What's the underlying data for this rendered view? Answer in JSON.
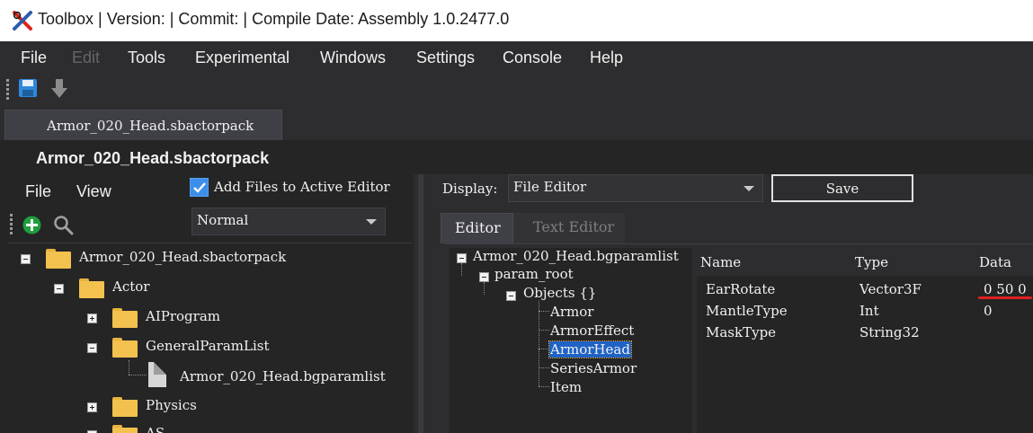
{
  "window": {
    "title": "Toolbox | Version:  | Commit:  | Compile Date:  Assembly 1.0.2477.0",
    "app_icon": "crossed-tools-icon"
  },
  "menubar": {
    "items": [
      "File",
      "Edit",
      "Tools",
      "Experimental",
      "Windows",
      "Settings",
      "Console",
      "Help"
    ],
    "disabled": [
      "Edit"
    ]
  },
  "toolbar": {
    "icons": [
      "save-icon",
      "import-arrow-icon"
    ]
  },
  "document_tab": {
    "label": "Armor_020_Head.sbactorpack"
  },
  "document_header": {
    "title": "Armor_020_Head.sbactorpack"
  },
  "left_pane": {
    "menu": [
      "File",
      "View"
    ],
    "add_files_checkbox": {
      "label": "Add Files to Active Editor",
      "checked": true
    },
    "view_mode": "Normal",
    "tool_icons": [
      "add-icon",
      "search-icon"
    ],
    "tree": [
      {
        "label": "Armor_020_Head.sbactorpack",
        "type": "folder",
        "expanded": true
      },
      {
        "label": "Actor",
        "type": "folder",
        "expanded": true
      },
      {
        "label": "AIProgram",
        "type": "folder",
        "expanded": false
      },
      {
        "label": "GeneralParamList",
        "type": "folder",
        "expanded": true
      },
      {
        "label": "Armor_020_Head.bgparamlist",
        "type": "file"
      },
      {
        "label": "Physics",
        "type": "folder",
        "expanded": false
      },
      {
        "label": "AS",
        "type": "folder",
        "expanded": false
      }
    ]
  },
  "right_pane": {
    "display_label": "Display:",
    "display_value": "File Editor",
    "save_label": "Save",
    "tabs": [
      {
        "label": "Editor",
        "active": true
      },
      {
        "label": "Text Editor",
        "active": false
      }
    ],
    "param_tree": {
      "root": "Armor_020_Head.bgparamlist",
      "param_root": "param_root",
      "objects": "Objects {}",
      "children": [
        "Armor",
        "ArmorEffect",
        "ArmorHead",
        "SeriesArmor",
        "Item"
      ],
      "selected": "ArmorHead"
    },
    "grid": {
      "headers": [
        "Name",
        "Type",
        "Data"
      ],
      "rows": [
        {
          "name": "EarRotate",
          "type": "Vector3F",
          "data": "0 50 0"
        },
        {
          "name": "MantleType",
          "type": "Int",
          "data": "0"
        },
        {
          "name": "MaskType",
          "type": "String32",
          "data": ""
        }
      ],
      "highlight_color": "#e01f1f"
    }
  },
  "colors": {
    "background": "#2d2d30",
    "panel": "#252526",
    "accent": "#3d8ee9",
    "selection": "#1f63c5"
  }
}
